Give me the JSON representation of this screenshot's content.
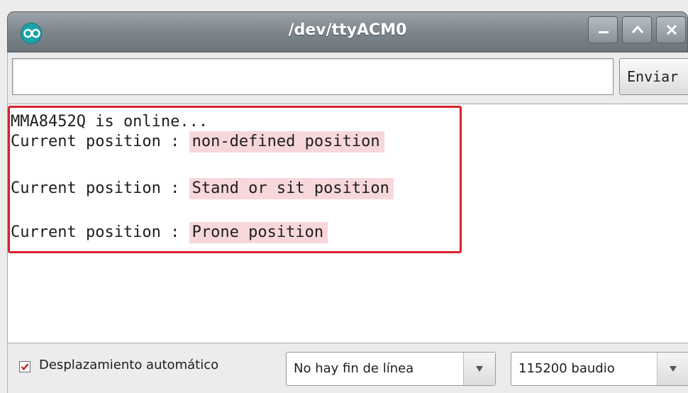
{
  "window": {
    "title": "/dev/ttyACM0",
    "app_icon": "arduino-logo-icon",
    "controls": [
      "minimize-icon",
      "maximize-icon",
      "close-icon"
    ]
  },
  "input_row": {
    "input_value": "",
    "send_label": "Enviar"
  },
  "output": {
    "lines": [
      {
        "prefix": "MMA8452Q is online...",
        "highlight": ""
      },
      {
        "prefix": "Current position : ",
        "highlight": "non-defined position"
      },
      {
        "prefix": "Current position : ",
        "highlight": "Stand or sit position"
      },
      {
        "prefix": "Current position : ",
        "highlight": "Prone position"
      }
    ],
    "highlight_box_color": "#d9212b",
    "highlight_fill_color": "#f7d7da"
  },
  "bottom_bar": {
    "autoscroll_checked": true,
    "autoscroll_label": "Desplazamiento automático",
    "line_ending": "No hay fin de línea",
    "baud_rate": "115200 baudio"
  }
}
